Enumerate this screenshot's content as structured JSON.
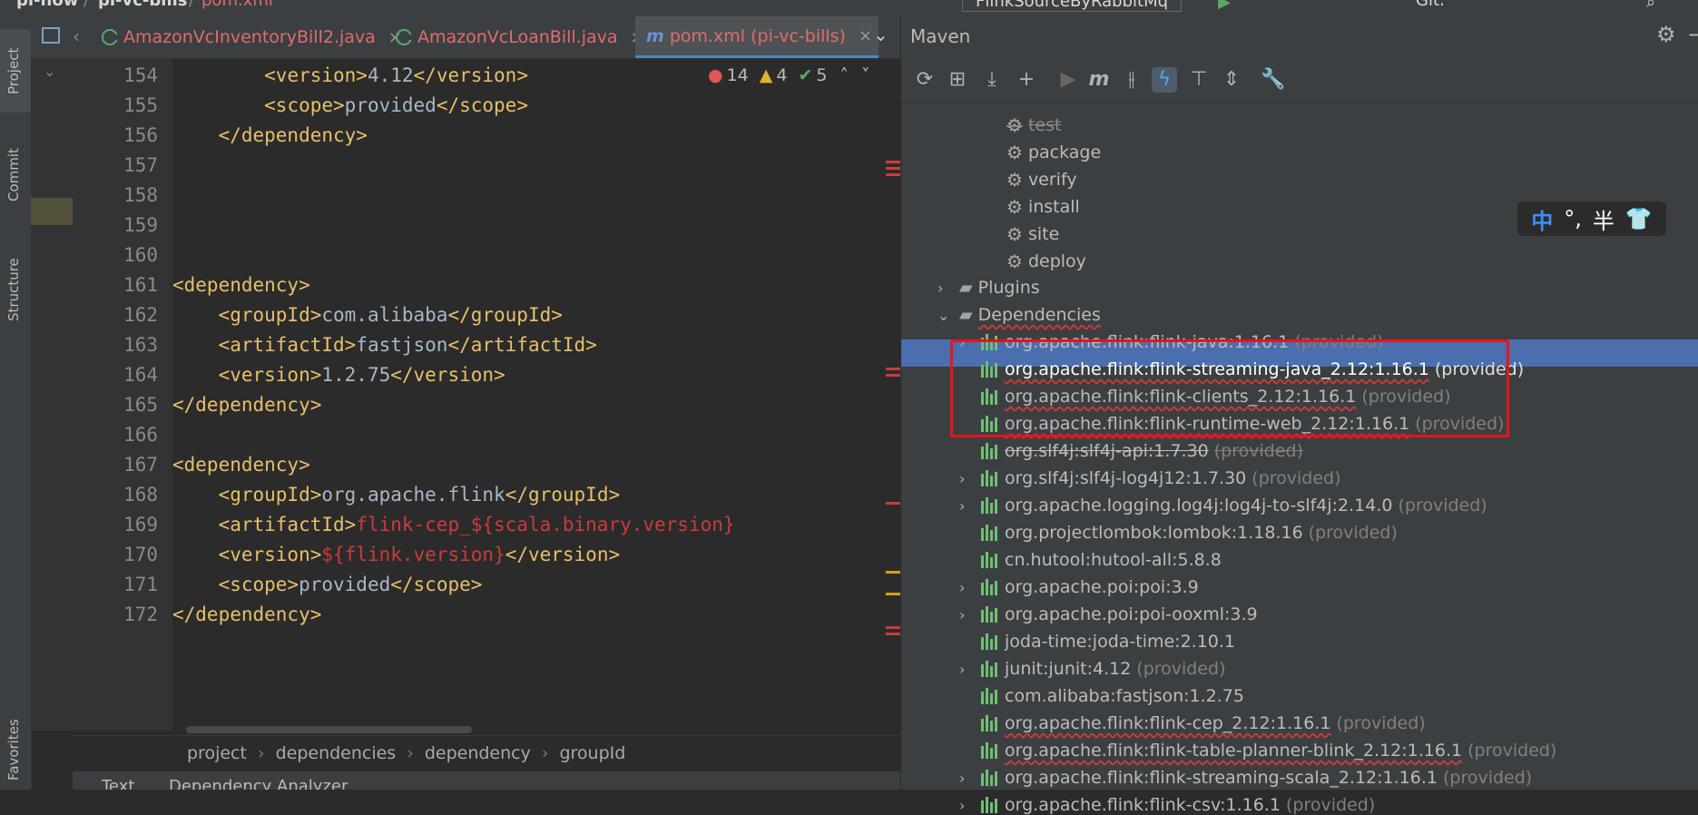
{
  "titlebar": {
    "crumbs": [
      "pi-now",
      "pi-vc-bills",
      "pom.xml"
    ],
    "run_config": "FlinkSourceByRabbitMq",
    "git_label": "Git:"
  },
  "left_tools": [
    "Project",
    "Commit",
    "Structure",
    "Favorites"
  ],
  "editor": {
    "tabs": [
      {
        "label": "AmazonVcInventoryBill2.java",
        "color": "#e06c6c"
      },
      {
        "label": "AmazonVcLoanBill.java",
        "color": "#e06c6c"
      },
      {
        "label": "pom.xml (pi-vc-bills)",
        "color": "#e06c6c",
        "icon": "m"
      }
    ],
    "inspections": {
      "errors": "14",
      "warnings": "4",
      "ok": "5"
    },
    "lines": [
      {
        "n": "154",
        "indent": "        ",
        "open": "<version>",
        "text": "4.12",
        "close": "</version>"
      },
      {
        "n": "155",
        "indent": "        ",
        "open": "<scope>",
        "text": "provided",
        "close": "</scope>"
      },
      {
        "n": "156",
        "indent": "    ",
        "open": "</dependency>",
        "text": "",
        "close": ""
      },
      {
        "n": "157",
        "indent": "",
        "open": "",
        "text": "",
        "close": ""
      },
      {
        "n": "158",
        "indent": "",
        "open": "",
        "text": "",
        "close": ""
      },
      {
        "n": "159",
        "indent": "",
        "open": "",
        "text": "",
        "close": ""
      },
      {
        "n": "160",
        "indent": "",
        "open": "",
        "text": "",
        "close": ""
      },
      {
        "n": "161",
        "indent": "",
        "open": "<dependency>",
        "text": "",
        "close": ""
      },
      {
        "n": "162",
        "indent": "    ",
        "open": "<groupId>",
        "text": "com.alibaba",
        "close": "</groupId>"
      },
      {
        "n": "163",
        "indent": "    ",
        "open": "<artifactId>",
        "text": "fastjson",
        "close": "</artifactId>"
      },
      {
        "n": "164",
        "indent": "    ",
        "open": "<version>",
        "text": "1.2.75",
        "close": "</version>"
      },
      {
        "n": "165",
        "indent": "",
        "open": "</dependency>",
        "text": "",
        "close": ""
      },
      {
        "n": "166",
        "indent": "",
        "open": "",
        "text": "",
        "close": ""
      },
      {
        "n": "167",
        "indent": "",
        "open": "<dependency>",
        "text": "",
        "close": ""
      },
      {
        "n": "168",
        "indent": "    ",
        "open": "<groupId>",
        "text": "org.apache.flink",
        "close": "</groupId>"
      },
      {
        "n": "169",
        "indent": "    ",
        "open": "<artifactId>",
        "text": "flink-cep_${scala.binary.version}",
        "close": "",
        "red": true
      },
      {
        "n": "170",
        "indent": "    ",
        "open": "<version>",
        "text": "${flink.version}",
        "close": "</version>",
        "red": true
      },
      {
        "n": "171",
        "indent": "    ",
        "open": "<scope>",
        "text": "provided",
        "close": "</scope>"
      },
      {
        "n": "172",
        "indent": "",
        "open": "</dependency>",
        "text": "",
        "close": ""
      }
    ],
    "breadcrumb": [
      "project",
      "dependencies",
      "dependency",
      "groupId"
    ],
    "bottom_tabs": [
      "Text",
      "Dependency Analyzer"
    ]
  },
  "maven": {
    "title": "Maven",
    "lifecycle": [
      "test",
      "package",
      "verify",
      "install",
      "site",
      "deploy"
    ],
    "plugins_label": "Plugins",
    "dependencies_label": "Dependencies",
    "dependencies": [
      {
        "name": "org.apache.flink:flink-java:1.16.1",
        "scope": "(provided)",
        "expand": true,
        "wavy": false
      },
      {
        "name": "org.apache.flink:flink-streaming-java_2.12:1.16.1",
        "scope": "(provided)",
        "expand": false,
        "wavy": true,
        "selected": true
      },
      {
        "name": "org.apache.flink:flink-clients_2.12:1.16.1",
        "scope": "(provided)",
        "expand": false,
        "wavy": true
      },
      {
        "name": "org.apache.flink:flink-runtime-web_2.12:1.16.1",
        "scope": "(provided)",
        "expand": false,
        "wavy": true
      },
      {
        "name": "org.slf4j:slf4j-api:1.7.30",
        "scope": "(provided)",
        "expand": false,
        "wavy": false,
        "strike": true
      },
      {
        "name": "org.slf4j:slf4j-log4j12:1.7.30",
        "scope": "(provided)",
        "expand": true,
        "wavy": false
      },
      {
        "name": "org.apache.logging.log4j:log4j-to-slf4j:2.14.0",
        "scope": "(provided)",
        "expand": true,
        "wavy": false
      },
      {
        "name": "org.projectlombok:lombok:1.18.16",
        "scope": "(provided)",
        "expand": false,
        "wavy": false
      },
      {
        "name": "cn.hutool:hutool-all:5.8.8",
        "scope": "",
        "expand": false,
        "wavy": false
      },
      {
        "name": "org.apache.poi:poi:3.9",
        "scope": "",
        "expand": true,
        "wavy": false
      },
      {
        "name": "org.apache.poi:poi-ooxml:3.9",
        "scope": "",
        "expand": true,
        "wavy": false
      },
      {
        "name": "joda-time:joda-time:2.10.1",
        "scope": "",
        "expand": false,
        "wavy": false
      },
      {
        "name": "junit:junit:4.12",
        "scope": "(provided)",
        "expand": true,
        "wavy": false
      },
      {
        "name": "com.alibaba:fastjson:1.2.75",
        "scope": "",
        "expand": false,
        "wavy": false
      },
      {
        "name": "org.apache.flink:flink-cep_2.12:1.16.1",
        "scope": "(provided)",
        "expand": false,
        "wavy": true
      },
      {
        "name": "org.apache.flink:flink-table-planner-blink_2.12:1.16.1",
        "scope": "(provided)",
        "expand": false,
        "wavy": true
      },
      {
        "name": "org.apache.flink:flink-streaming-scala_2.12:1.16.1",
        "scope": "(provided)",
        "expand": true,
        "wavy": false
      },
      {
        "name": "org.apache.flink:flink-csv:1.16.1",
        "scope": "(provided)",
        "expand": true,
        "wavy": false
      }
    ]
  },
  "ime": {
    "zh": "中",
    "punct": "°,",
    "half": "半",
    "skin_icon": "shirt-icon"
  },
  "colors": {
    "accent": "#4b6eaf",
    "highlight_box": "#e8141a",
    "xml_tag": "#e8bf6a",
    "error": "#cc3b3b"
  }
}
